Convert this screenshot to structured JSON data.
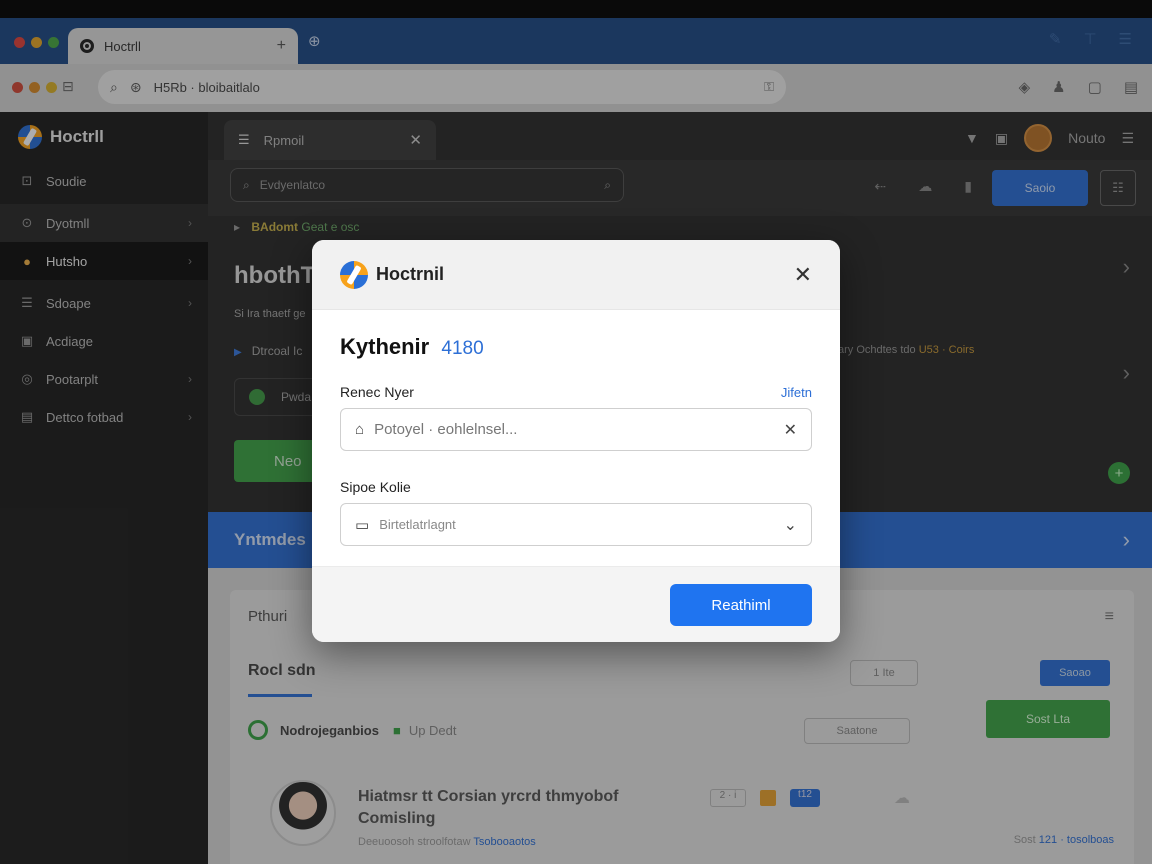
{
  "browser": {
    "tab_title": "Hoctrll",
    "tab_plus": "+",
    "new_tab": "⊕",
    "url": "H5Rb · bloibaitlalo",
    "colors": {
      "red": "#e0443e",
      "yellow": "#e5a72a",
      "green": "#4aa845"
    }
  },
  "sidebar": {
    "brand": "Hoctrll",
    "items": [
      {
        "label": "Soudie",
        "icon": "⊡"
      },
      {
        "label": "Dyotmll",
        "icon": "⊙"
      },
      {
        "label": "Hutsho",
        "icon": "●"
      },
      {
        "label": "Sdoape",
        "icon": "☰"
      },
      {
        "label": "Acdiage",
        "icon": "▣"
      },
      {
        "label": "Pootarplt",
        "icon": "◎"
      },
      {
        "label": "Dettco fotbad",
        "icon": "▤"
      }
    ]
  },
  "main": {
    "tab_label": "Rpmoil",
    "search_placeholder": "Evdyenlatco",
    "top_user": "Nouto",
    "blue_button": "Saoio",
    "breadcrumb": "BAdomt",
    "breadcrumb_rest": "Geat e osc",
    "big_title": "hbothT",
    "subline": "Si Ira thaetf ge",
    "bullet": "Dtrcoal Ic",
    "pill_label": "Pwda",
    "green_button": "Neo",
    "right_text": "ary Ochdtes tdo",
    "right_text_accent": "U53 · Coirs",
    "banner": "Yntmdes"
  },
  "card": {
    "header": "Pthuri",
    "subheader": "Rocl sdn",
    "outline_btn_1": "1 Ite",
    "outline_btn_2": "Saatone",
    "blue_small": "Saoao",
    "green_large": "Sost Lta",
    "check_label": "Nodrojeganbios",
    "check_tag": "Up Dedt",
    "post_title": "Hiatmsr tt Corsian yrcrd thmyobof Comisling",
    "post_meta": "Deeuoosoh stroolfotaw",
    "post_meta_link": "Tsobooaotos",
    "tag_1": "2 · i",
    "tag_2": "t12",
    "right_meta": "Sost",
    "right_meta_link": "121 · tosolboas"
  },
  "modal": {
    "brand": "Hoctrnil",
    "title": "Kythenir",
    "title_num": "4180",
    "field1_label": "Renec Nyer",
    "field1_link": "Jifetn",
    "field1_placeholder": "Potoyel · eohlelnsel...",
    "field2_label": "Sipoe Kolie",
    "field2_value": "Birtetlatrlagnt",
    "primary_button": "Reathiml"
  }
}
